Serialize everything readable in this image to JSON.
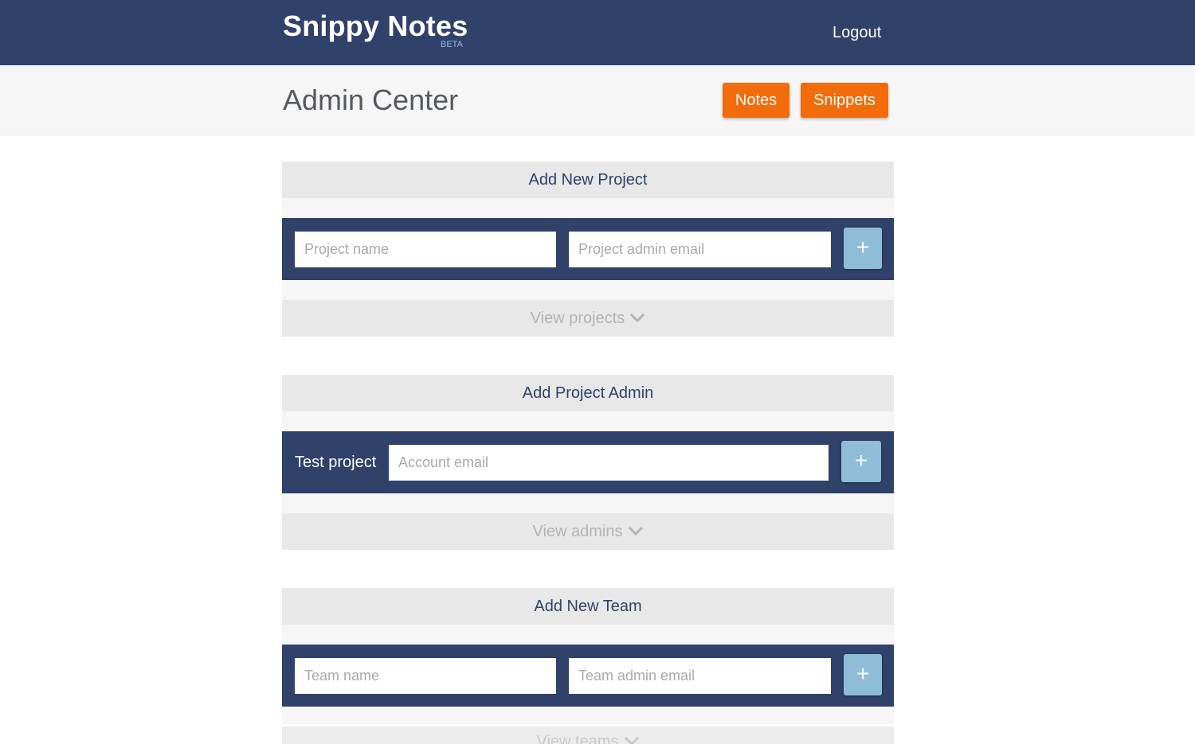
{
  "header": {
    "brand": "Snippy Notes",
    "beta": "BETA",
    "logout": "Logout"
  },
  "subheader": {
    "title": "Admin Center",
    "notes_button": "Notes",
    "snippets_button": "Snippets"
  },
  "sections": {
    "project": {
      "title": "Add New Project",
      "name_placeholder": "Project name",
      "email_placeholder": "Project admin email",
      "add_label": "+",
      "view_label": "View projects"
    },
    "admin": {
      "title": "Add Project Admin",
      "project_label": "Test project",
      "email_placeholder": "Account email",
      "add_label": "+",
      "view_label": "View admins"
    },
    "team": {
      "title": "Add New Team",
      "name_placeholder": "Team name",
      "email_placeholder": "Team admin email",
      "add_label": "+",
      "view_label": "View teams"
    }
  },
  "colors": {
    "navy": "#30416a",
    "orange": "#f36c0b",
    "light_blue": "#8fbcd6",
    "panel_gray": "#e8e8e8"
  }
}
